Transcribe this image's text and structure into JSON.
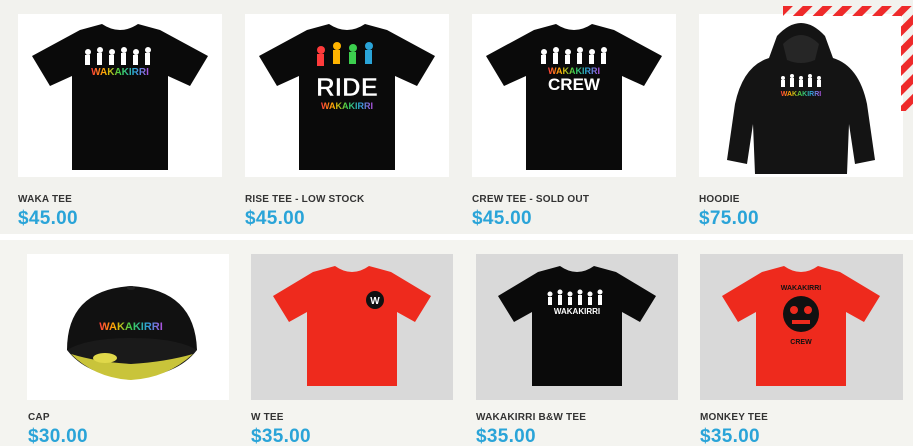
{
  "products": [
    {
      "name": "WAKA TEE",
      "price": "$45.00",
      "graphic": "WAKAKIRRI"
    },
    {
      "name": "RISE TEE - LOW STOCK",
      "price": "$45.00",
      "graphic_top": "RIDE",
      "graphic": "WAKAKIRRI"
    },
    {
      "name": "CREW TEE - SOLD OUT",
      "price": "$45.00",
      "graphic": "WAKAKIRRI",
      "graphic_bottom": "CREW"
    },
    {
      "name": "HOODIE",
      "price": "$75.00",
      "graphic": "WAKAKIRRI"
    },
    {
      "name": "CAP",
      "price": "$30.00",
      "graphic": "WAKAKIRRI"
    },
    {
      "name": "W TEE",
      "price": "$35.00",
      "graphic": "W"
    },
    {
      "name": "WAKAKIRRI B&W TEE",
      "price": "$35.00",
      "graphic": "WAKAKIRRI"
    },
    {
      "name": "MONKEY TEE",
      "price": "$35.00",
      "graphic_top": "WAKAKIRRI",
      "graphic_bottom": "CREW"
    }
  ],
  "colors": {
    "price": "#2aa4d8",
    "shirt_black": "#0a0a0a",
    "shirt_red": "#ee2a1d",
    "sale_stripe": "#ee2a2a"
  }
}
